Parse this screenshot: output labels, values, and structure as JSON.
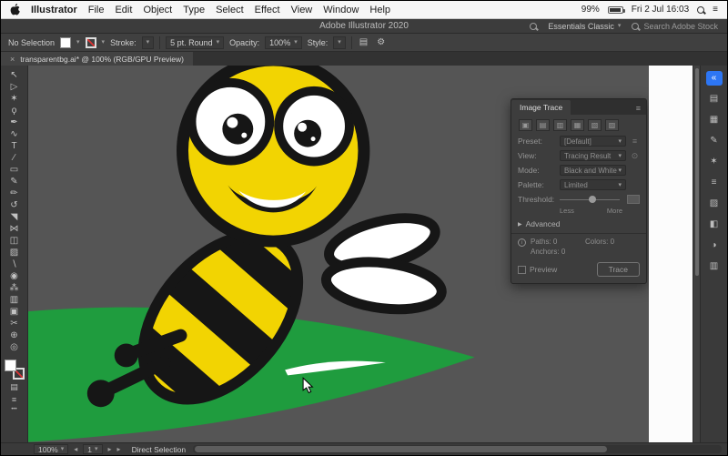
{
  "menubar": {
    "app_name": "Illustrator",
    "menus": [
      "File",
      "Edit",
      "Object",
      "Type",
      "Select",
      "Effect",
      "View",
      "Window",
      "Help"
    ],
    "battery_percent": "99%",
    "clock": "Fri 2 Jul 16:03"
  },
  "titlebar": {
    "title": "Adobe Illustrator 2020",
    "workspace": "Essentials Classic",
    "stock_search": "Search Adobe Stock"
  },
  "controlbar": {
    "selection_status": "No Selection",
    "stroke_label": "Stroke:",
    "brush_value": "5 pt. Round",
    "opacity_label": "Opacity:",
    "opacity_value": "100%",
    "style_label": "Style:"
  },
  "doctab": {
    "title": "transparentbg.ai* @ 100% (RGB/GPU Preview)"
  },
  "tools": [
    {
      "name": "selection",
      "glyph": "↖"
    },
    {
      "name": "direct-selection",
      "glyph": "▷"
    },
    {
      "name": "magic-wand",
      "glyph": "✶"
    },
    {
      "name": "lasso",
      "glyph": "ϙ"
    },
    {
      "name": "pen",
      "glyph": "✒"
    },
    {
      "name": "curvature",
      "glyph": "∿"
    },
    {
      "name": "type",
      "glyph": "T"
    },
    {
      "name": "line-segment",
      "glyph": "∕"
    },
    {
      "name": "rectangle",
      "glyph": "▭"
    },
    {
      "name": "paintbrush",
      "glyph": "✎"
    },
    {
      "name": "pencil",
      "glyph": "✏"
    },
    {
      "name": "rotate",
      "glyph": "↺"
    },
    {
      "name": "scale",
      "glyph": "◥"
    },
    {
      "name": "width",
      "glyph": "⋈"
    },
    {
      "name": "shape-builder",
      "glyph": "◫"
    },
    {
      "name": "gradient",
      "glyph": "▨"
    },
    {
      "name": "eyedropper",
      "glyph": "∖"
    },
    {
      "name": "blend",
      "glyph": "◉"
    },
    {
      "name": "symbol-sprayer",
      "glyph": "⁂"
    },
    {
      "name": "column-graph",
      "glyph": "▥"
    },
    {
      "name": "artboard",
      "glyph": "▣"
    },
    {
      "name": "slice",
      "glyph": "✂"
    },
    {
      "name": "hand",
      "glyph": "⊕"
    },
    {
      "name": "zoom",
      "glyph": "◎"
    }
  ],
  "image_trace": {
    "tab": "Image Trace",
    "preset_buttons": [
      {
        "name": "auto-color",
        "glyph": "▣"
      },
      {
        "name": "high-color",
        "glyph": "▤"
      },
      {
        "name": "low-color",
        "glyph": "▥"
      },
      {
        "name": "grayscale",
        "glyph": "▦"
      },
      {
        "name": "black-and-white",
        "glyph": "▧"
      },
      {
        "name": "outline",
        "glyph": "▨"
      }
    ],
    "preset_label": "Preset:",
    "preset_value": "[Default]",
    "view_label": "View:",
    "view_value": "Tracing Result",
    "mode_label": "Mode:",
    "mode_value": "Black and White",
    "palette_label": "Palette:",
    "palette_value": "Limited",
    "threshold_label": "Threshold:",
    "less_label": "Less",
    "more_label": "More",
    "advanced_label": "Advanced",
    "paths_label": "Paths:",
    "paths_value": "0",
    "colors_label": "Colors:",
    "colors_value": "0",
    "anchors_label": "Anchors:",
    "anchors_value": "0",
    "preview_label": "Preview",
    "trace_label": "Trace"
  },
  "dock_icons": [
    {
      "name": "collapse-panels",
      "glyph": "«"
    },
    {
      "name": "color-panel",
      "glyph": "▤"
    },
    {
      "name": "swatches-panel",
      "glyph": "▦"
    },
    {
      "name": "brushes-panel",
      "glyph": "✎"
    },
    {
      "name": "symbols-panel",
      "glyph": "✶"
    },
    {
      "name": "stroke-panel",
      "glyph": "≡"
    },
    {
      "name": "gradient-panel",
      "glyph": "▨"
    },
    {
      "name": "transparency-panel",
      "glyph": "◧"
    },
    {
      "name": "appearance-panel",
      "glyph": "◑"
    },
    {
      "name": "layers-panel",
      "glyph": "▥"
    }
  ],
  "statusbar": {
    "zoom": "100%",
    "artboard": "1",
    "tool_name": "Direct Selection"
  },
  "icons": {
    "chevron_down": "▾",
    "menu": "≡",
    "close": "×",
    "eye": "⊙",
    "triangle_right": "▶",
    "arrow_left": "◂",
    "arrow_right": "▸",
    "ellipsis": "•••",
    "grid": "▤",
    "gear": "⚙"
  },
  "colors": {
    "canvas_gray": "#555555",
    "bee_yellow": "#F2D402",
    "bee_black": "#161616",
    "leaf_green": "#1F9C3E",
    "accent_blue": "#2D76F4",
    "artboard_white": "#FCFCFC"
  }
}
